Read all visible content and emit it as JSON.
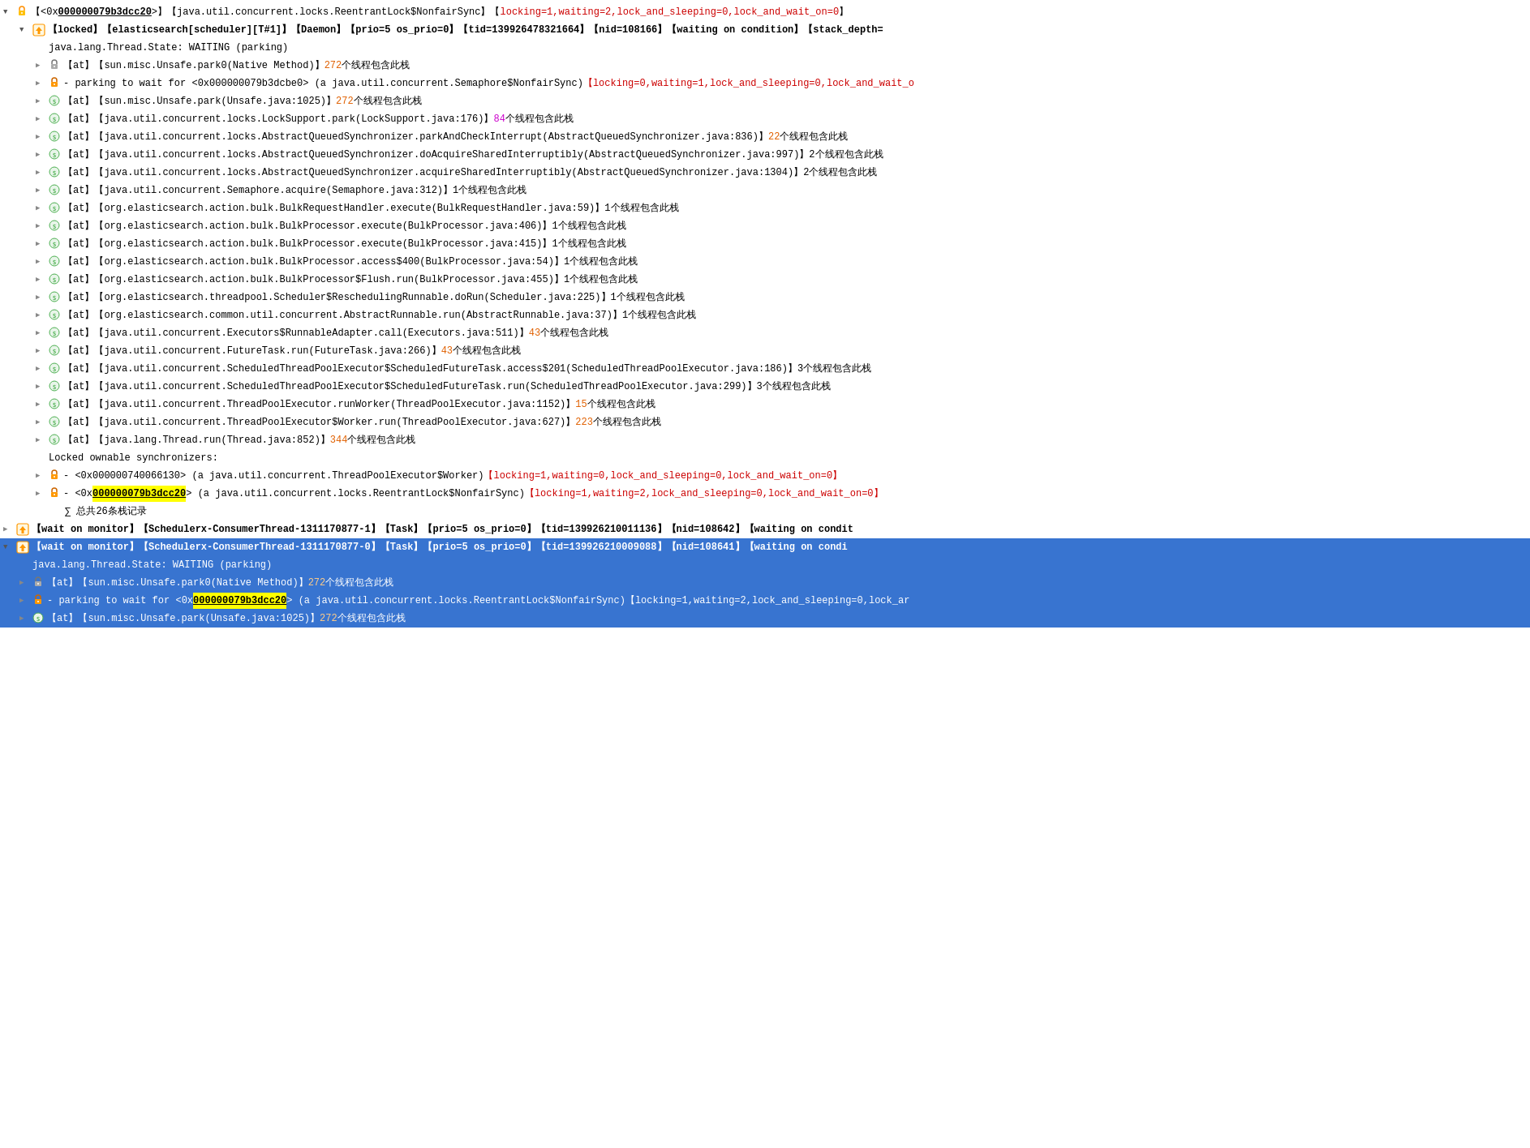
{
  "rows": [
    {
      "id": "r1",
      "indent": 0,
      "toggle": "open",
      "iconType": "lock-yellow",
      "hasLockIcon": true,
      "content": [
        {
          "type": "icon-lock",
          "color": "yellow"
        },
        {
          "type": "text",
          "value": "【<0x"
        },
        {
          "type": "text-bold-underline",
          "value": "000000079b3dcc20"
        },
        {
          "type": "text",
          "value": ">】【java.util.concurrent.locks.ReentrantLock$NonfairSync】【"
        },
        {
          "type": "text-red",
          "value": "locking=1,waiting=2,lock_and_sleeping=0,lock_and_wait_on=0"
        },
        {
          "type": "text",
          "value": "】"
        }
      ],
      "raw": "【<0x000000079b3dcc20>】【java.util.concurrent.locks.ReentrantLock$NonfairSync】【locking=1,waiting=2,lock_and_sleeping=O,lock_and_wait_on=0】"
    },
    {
      "id": "r2",
      "indent": 1,
      "toggle": "open",
      "iconType": "thread-yellow",
      "content": [
        {
          "type": "icon-thread",
          "color": "yellow"
        },
        {
          "type": "text-bold",
          "value": "【locked】【elasticsearch[scheduler][T#1]】【Daemon】【prio=5 os_prio=0】【tid=139926478321664】【nid=108166】【waiting on condition】【stack_depth="
        }
      ]
    },
    {
      "id": "r3",
      "indent": 2,
      "toggle": "none",
      "content": [
        {
          "type": "text",
          "value": "java.lang.Thread.State: WAITING (parking)"
        }
      ]
    },
    {
      "id": "r4",
      "indent": 2,
      "toggle": "leaf",
      "iconType": "stack-green",
      "content": [
        {
          "type": "icon-lock",
          "color": "gray"
        },
        {
          "type": "text",
          "value": "【at】【sun.misc.Unsafe.park0(Native Method)】"
        },
        {
          "type": "text-orange",
          "value": "272"
        },
        {
          "type": "text",
          "value": "个线程包含此栈"
        }
      ]
    },
    {
      "id": "r5",
      "indent": 2,
      "toggle": "leaf",
      "content": [
        {
          "type": "icon-lock",
          "color": "orange"
        },
        {
          "type": "text",
          "value": "- parking to wait for <0x000000079b3dcbe0> (a java.util.concurrent.Semaphore$NonfairSync)"
        },
        {
          "type": "text-red",
          "value": "【locking=0,waiting=1,lock_and_sleeping=0,lock_and_wait_o"
        }
      ]
    },
    {
      "id": "r6",
      "indent": 2,
      "toggle": "leaf",
      "iconType": "stack-green",
      "content": [
        {
          "type": "icon-stack",
          "color": "green"
        },
        {
          "type": "text",
          "value": "【at】【sun.misc.Unsafe.park(Unsafe.java:1025)】"
        },
        {
          "type": "text-orange",
          "value": "272"
        },
        {
          "type": "text",
          "value": "个线程包含此栈"
        }
      ]
    },
    {
      "id": "r7",
      "indent": 2,
      "toggle": "leaf",
      "content": [
        {
          "type": "icon-stack",
          "color": "green"
        },
        {
          "type": "text",
          "value": "【at】【java.util.concurrent.locks.LockSupport.park(LockSupport.java:176)】"
        },
        {
          "type": "text-magenta",
          "value": "84"
        },
        {
          "type": "text",
          "value": "个线程包含此栈"
        }
      ]
    },
    {
      "id": "r8",
      "indent": 2,
      "toggle": "leaf",
      "content": [
        {
          "type": "icon-stack",
          "color": "green"
        },
        {
          "type": "text",
          "value": "【at】【java.util.concurrent.locks.AbstractQueuedSynchronizer.parkAndCheckInterrupt(AbstractQueuedSynchronizer.java:836)】"
        },
        {
          "type": "text-orange",
          "value": "22"
        },
        {
          "type": "text",
          "value": "个线程包含此栈"
        }
      ]
    },
    {
      "id": "r9",
      "indent": 2,
      "toggle": "leaf",
      "content": [
        {
          "type": "icon-stack",
          "color": "green"
        },
        {
          "type": "text",
          "value": "【at】【java.util.concurrent.locks.AbstractQueuedSynchronizer.doAcquireSharedInterruptibly(AbstractQueuedSynchronizer.java:997)】2个线程包含此栈"
        }
      ]
    },
    {
      "id": "r10",
      "indent": 2,
      "toggle": "leaf",
      "content": [
        {
          "type": "icon-stack",
          "color": "green"
        },
        {
          "type": "text",
          "value": "【at】【java.util.concurrent.locks.AbstractQueuedSynchronizer.acquireSharedInterruptibly(AbstractQueuedSynchronizer.java:1304)】2个线程包含此栈"
        }
      ]
    },
    {
      "id": "r11",
      "indent": 2,
      "toggle": "leaf",
      "content": [
        {
          "type": "icon-stack",
          "color": "green"
        },
        {
          "type": "text",
          "value": "【at】【java.util.concurrent.Semaphore.acquire(Semaphore.java:312)】1个线程包含此栈"
        }
      ]
    },
    {
      "id": "r12",
      "indent": 2,
      "toggle": "leaf",
      "content": [
        {
          "type": "icon-stack",
          "color": "green"
        },
        {
          "type": "text",
          "value": "【at】【org.elasticsearch.action.bulk.BulkRequestHandler.execute(BulkRequestHandler.java:59)】1个线程包含此栈"
        }
      ]
    },
    {
      "id": "r13",
      "indent": 2,
      "toggle": "leaf",
      "content": [
        {
          "type": "icon-stack",
          "color": "green"
        },
        {
          "type": "text",
          "value": "【at】【org.elasticsearch.action.bulk.BulkProcessor.execute(BulkProcessor.java:406)】1个线程包含此栈"
        }
      ]
    },
    {
      "id": "r14",
      "indent": 2,
      "toggle": "leaf",
      "content": [
        {
          "type": "icon-stack",
          "color": "green"
        },
        {
          "type": "text",
          "value": "【at】【org.elasticsearch.action.bulk.BulkProcessor.execute(BulkProcessor.java:415)】1个线程包含此栈"
        }
      ]
    },
    {
      "id": "r15",
      "indent": 2,
      "toggle": "leaf",
      "content": [
        {
          "type": "icon-stack",
          "color": "green"
        },
        {
          "type": "text",
          "value": "【at】【org.elasticsearch.action.bulk.BulkProcessor.access$400(BulkProcessor.java:54)】1个线程包含此栈"
        }
      ]
    },
    {
      "id": "r16",
      "indent": 2,
      "toggle": "leaf",
      "content": [
        {
          "type": "icon-stack",
          "color": "green"
        },
        {
          "type": "text",
          "value": "【at】【org.elasticsearch.action.bulk.BulkProcessor$Flush.run(BulkProcessor.java:455)】1个线程包含此栈"
        }
      ]
    },
    {
      "id": "r17",
      "indent": 2,
      "toggle": "leaf",
      "content": [
        {
          "type": "icon-stack",
          "color": "green"
        },
        {
          "type": "text",
          "value": "【at】【org.elasticsearch.threadpool.Scheduler$ReschedulingRunnable.doRun(Scheduler.java:225)】1个线程包含此栈"
        }
      ]
    },
    {
      "id": "r18",
      "indent": 2,
      "toggle": "leaf",
      "content": [
        {
          "type": "icon-stack",
          "color": "green"
        },
        {
          "type": "text",
          "value": "【at】【org.elasticsearch.common.util.concurrent.AbstractRunnable.run(AbstractRunnable.java:37)】1个线程包含此栈"
        }
      ]
    },
    {
      "id": "r19",
      "indent": 2,
      "toggle": "leaf",
      "content": [
        {
          "type": "icon-stack",
          "color": "green"
        },
        {
          "type": "text",
          "value": "【at】【java.util.concurrent.Executors$RunnableAdapter.call(Executors.java:511)】"
        },
        {
          "type": "text-orange",
          "value": "43"
        },
        {
          "type": "text",
          "value": "个线程包含此栈"
        }
      ]
    },
    {
      "id": "r20",
      "indent": 2,
      "toggle": "leaf",
      "content": [
        {
          "type": "icon-stack",
          "color": "green"
        },
        {
          "type": "text",
          "value": "【at】【java.util.concurrent.FutureTask.run(FutureTask.java:266)】"
        },
        {
          "type": "text-orange",
          "value": "43"
        },
        {
          "type": "text",
          "value": "个线程包含此栈"
        }
      ]
    },
    {
      "id": "r21",
      "indent": 2,
      "toggle": "leaf",
      "content": [
        {
          "type": "icon-stack",
          "color": "green"
        },
        {
          "type": "text",
          "value": "【at】【java.util.concurrent.ScheduledThreadPoolExecutor$ScheduledFutureTask.access$201(ScheduledThreadPoolExecutor.java:186)】3个线程包含此栈"
        }
      ]
    },
    {
      "id": "r22",
      "indent": 2,
      "toggle": "leaf",
      "content": [
        {
          "type": "icon-stack",
          "color": "green"
        },
        {
          "type": "text",
          "value": "【at】【java.util.concurrent.ScheduledThreadPoolExecutor$ScheduledFutureTask.run(ScheduledThreadPoolExecutor.java:299)】3个线程包含此栈"
        }
      ]
    },
    {
      "id": "r23",
      "indent": 2,
      "toggle": "leaf",
      "content": [
        {
          "type": "icon-stack",
          "color": "green"
        },
        {
          "type": "text",
          "value": "【at】【java.util.concurrent.ThreadPoolExecutor.runWorker(ThreadPoolExecutor.java:1152)】"
        },
        {
          "type": "text-orange",
          "value": "15"
        },
        {
          "type": "text",
          "value": "个线程包含此栈"
        }
      ]
    },
    {
      "id": "r24",
      "indent": 2,
      "toggle": "leaf",
      "content": [
        {
          "type": "icon-stack",
          "color": "green"
        },
        {
          "type": "text",
          "value": "【at】【java.util.concurrent.ThreadPoolExecutor$Worker.run(ThreadPoolExecutor.java:627)】"
        },
        {
          "type": "text-orange",
          "value": "223"
        },
        {
          "type": "text",
          "value": "个线程包含此栈"
        }
      ]
    },
    {
      "id": "r25",
      "indent": 2,
      "toggle": "leaf",
      "content": [
        {
          "type": "icon-stack",
          "color": "green"
        },
        {
          "type": "text",
          "value": "【at】【java.lang.Thread.run(Thread.java:852)】"
        },
        {
          "type": "text-orange",
          "value": "344"
        },
        {
          "type": "text",
          "value": "个线程包含此栈"
        }
      ]
    },
    {
      "id": "r26",
      "indent": 2,
      "toggle": "none",
      "content": [
        {
          "type": "text",
          "value": "Locked ownable synchronizers:"
        }
      ]
    },
    {
      "id": "r27",
      "indent": 2,
      "toggle": "leaf",
      "content": [
        {
          "type": "icon-lock",
          "color": "orange"
        },
        {
          "type": "text",
          "value": "- <0x000000740066130> (a java.util.concurrent.ThreadPoolExecutor$Worker)"
        },
        {
          "type": "text-red",
          "value": "【locking=1,waiting=0,lock_and_sleeping=0,lock_and_wait_on=0】"
        }
      ]
    },
    {
      "id": "r28",
      "indent": 2,
      "toggle": "leaf",
      "content": [
        {
          "type": "icon-lock",
          "color": "orange"
        },
        {
          "type": "text",
          "value": "- <0x"
        },
        {
          "type": "text-bold-underline-yellow",
          "value": "000000079b3dcc20"
        },
        {
          "type": "text",
          "value": "> (a java.util.concurrent.locks.ReentrantLock$NonfairSync)"
        },
        {
          "type": "text-red",
          "value": "【locking=1,waiting=2,lock_and_sleeping=0,lock_and_wait_on=0】"
        }
      ]
    },
    {
      "id": "r29",
      "indent": 2,
      "toggle": "none",
      "isSum": true,
      "content": [
        {
          "type": "text",
          "value": "∑ 总共26条栈记录"
        }
      ]
    },
    {
      "id": "r30",
      "indent": 0,
      "toggle": "leaf",
      "iconType": "thread-yellow",
      "content": [
        {
          "type": "icon-thread",
          "color": "yellow"
        },
        {
          "type": "text-bold",
          "value": "【wait on monitor】【Schedulerx-ConsumerThread-1311170877-1】【Task】【prio=5 os_prio=0】【tid=139926210011136】【nid=108642】【waiting on condit"
        }
      ]
    },
    {
      "id": "r31",
      "indent": 0,
      "toggle": "open",
      "iconType": "thread-yellow",
      "highlighted": true,
      "content": [
        {
          "type": "icon-thread",
          "color": "yellow"
        },
        {
          "type": "text-bold",
          "value": "【wait on monitor】【Schedulerx-ConsumerThread-1311170877-0】【Task】【prio=5 os_prio=0】【tid=139926210009088】【nid=108641】【waiting on condi"
        }
      ]
    },
    {
      "id": "r32",
      "indent": 1,
      "toggle": "none",
      "highlighted": true,
      "content": [
        {
          "type": "text",
          "value": "java.lang.Thread.State: WAITING (parking)"
        }
      ]
    },
    {
      "id": "r33",
      "indent": 1,
      "toggle": "leaf",
      "highlighted": true,
      "content": [
        {
          "type": "icon-lock",
          "color": "gray"
        },
        {
          "type": "text",
          "value": "【at】【sun.misc.Unsafe.park0(Native Method)】"
        },
        {
          "type": "text-orange-hl",
          "value": "272"
        },
        {
          "type": "text",
          "value": "个线程包含此栈"
        }
      ]
    },
    {
      "id": "r34",
      "indent": 1,
      "toggle": "leaf",
      "highlighted": true,
      "content": [
        {
          "type": "icon-lock",
          "color": "orange"
        },
        {
          "type": "text",
          "value": "- parking to wait for <0x"
        },
        {
          "type": "text-bold-underline-yellow",
          "value": "000000079b3dcc20"
        },
        {
          "type": "text",
          "value": "> (a java.util.concurrent.locks.ReentrantLock$NonfairSync)"
        },
        {
          "type": "text-red",
          "value": "【locking=1,waiting=2,lock_and_sleeping=0,lock_ar"
        }
      ]
    },
    {
      "id": "r35",
      "indent": 1,
      "toggle": "leaf",
      "highlighted": true,
      "content": [
        {
          "type": "icon-stack",
          "color": "green"
        },
        {
          "type": "text",
          "value": "【at】【sun.misc.Unsafe.park(Unsafe.java:1025)】"
        },
        {
          "type": "text-orange-hl",
          "value": "272"
        },
        {
          "type": "text",
          "value": "个线程包含此栈"
        }
      ]
    }
  ]
}
